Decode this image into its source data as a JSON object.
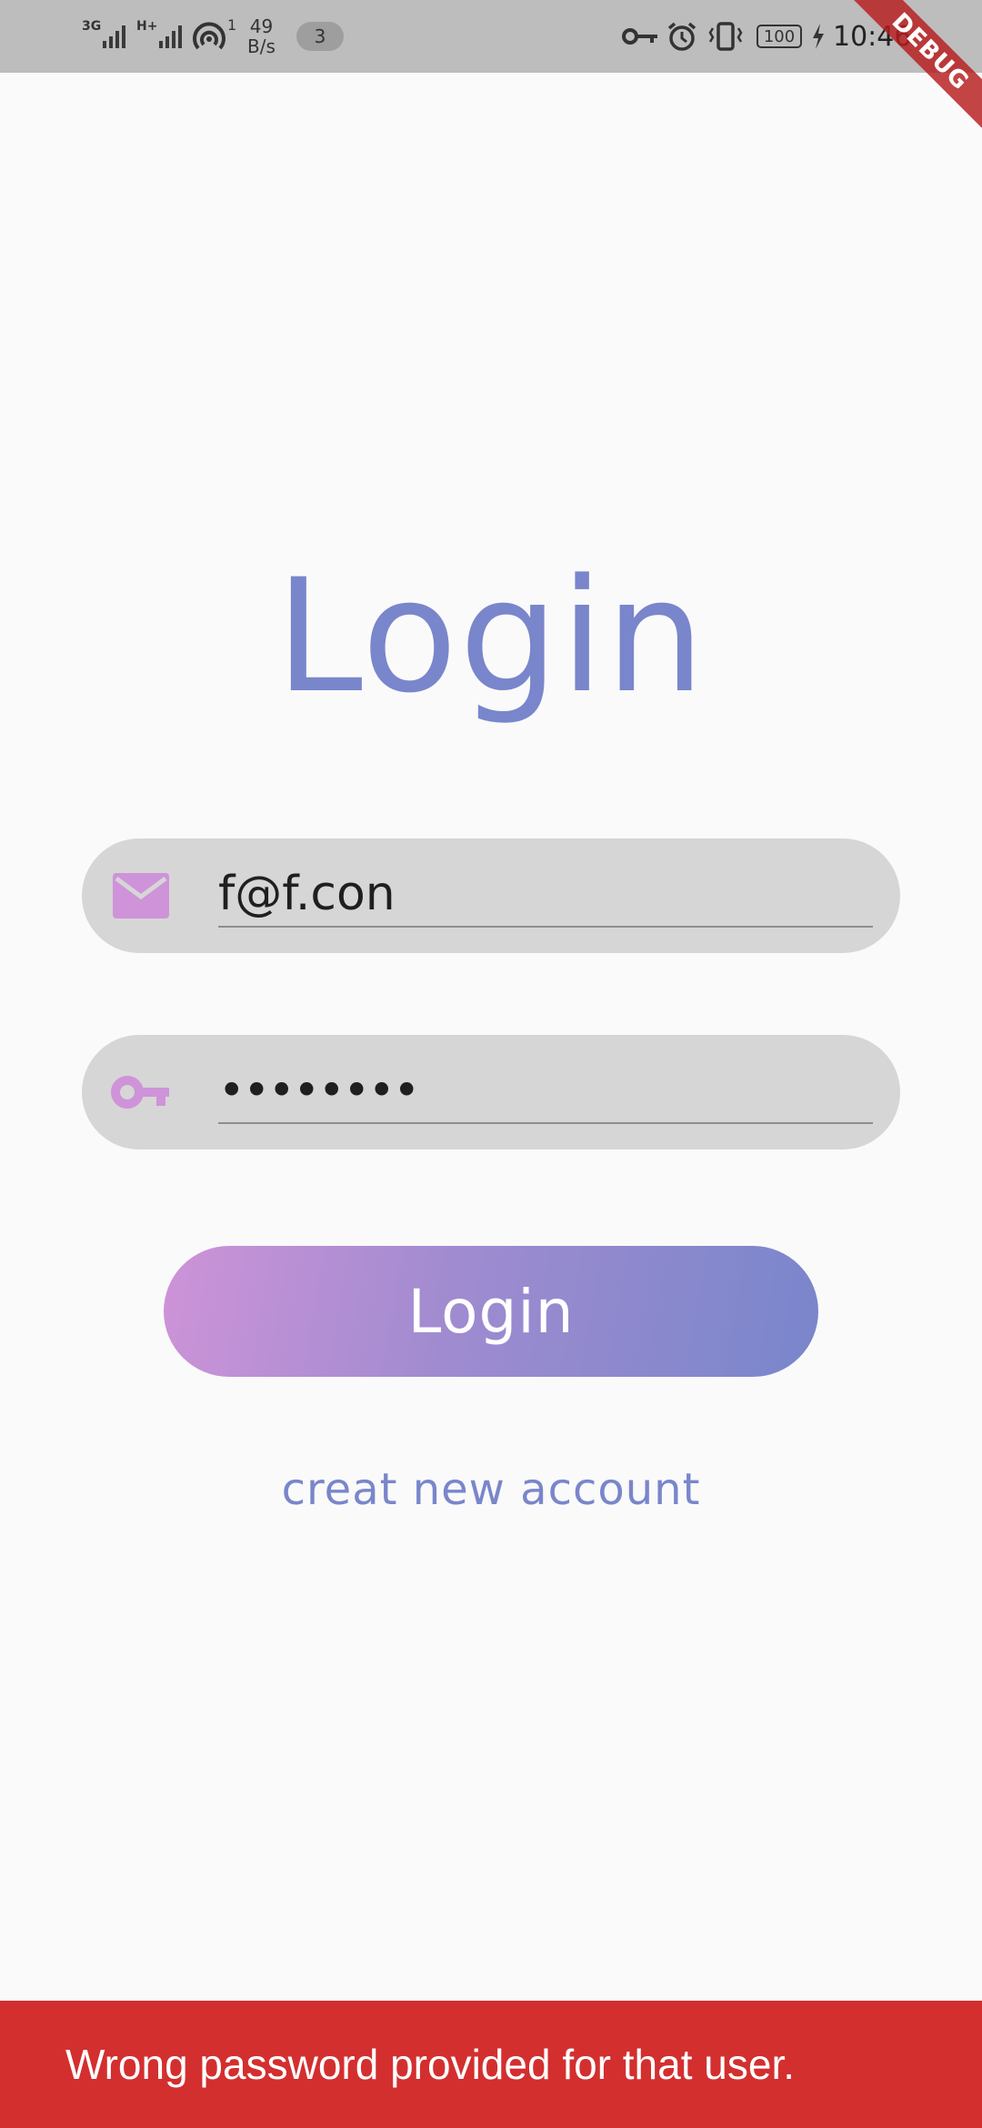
{
  "status_bar": {
    "network1": "3G",
    "network2": "H+",
    "hotspot_count": "1",
    "speed_value": "49",
    "speed_unit": "B/s",
    "notification_count": "3",
    "battery": "100",
    "time": "10:46"
  },
  "debug_banner": "DEBUG",
  "login": {
    "title": "Login",
    "email_value": "f@f.con",
    "password_value": "••••••••",
    "submit_label": "Login",
    "create_account_link": "creat new account"
  },
  "snackbar": {
    "message": "Wrong password provided for that user."
  },
  "colors": {
    "accent": "#7986cb",
    "icon": "#ce93d8",
    "field_bg": "#d6d6d6",
    "error": "#d32f2f"
  },
  "icons": {
    "email": "email-icon",
    "password": "key-icon"
  }
}
